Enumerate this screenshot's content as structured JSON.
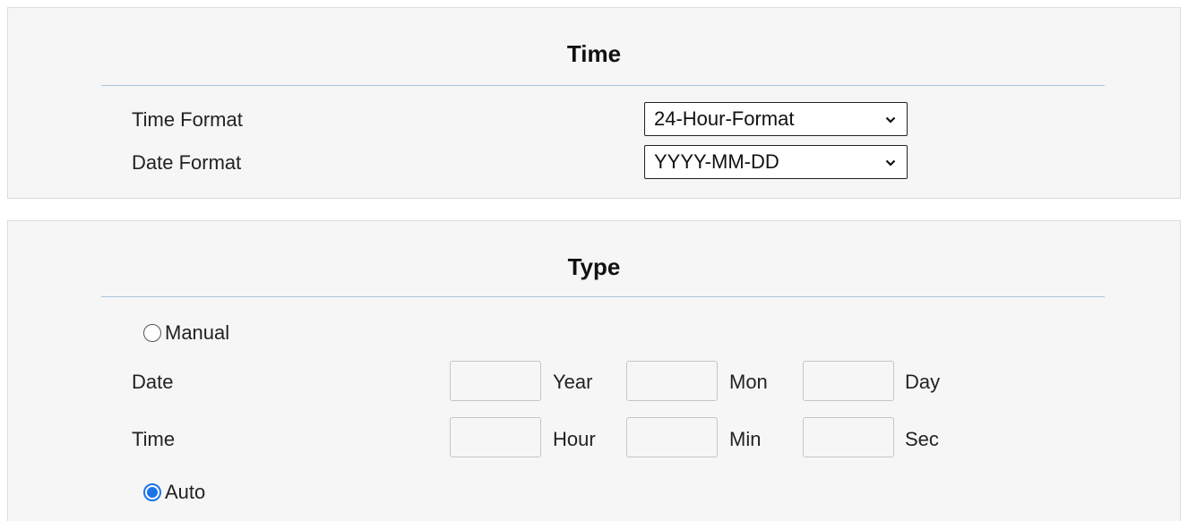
{
  "time_section": {
    "title": "Time",
    "time_format": {
      "label": "Time Format",
      "value": "24-Hour-Format"
    },
    "date_format": {
      "label": "Date Format",
      "value": "YYYY-MM-DD"
    }
  },
  "type_section": {
    "title": "Type",
    "manual": {
      "label": "Manual",
      "checked": false
    },
    "date_row": {
      "label": "Date",
      "year_unit": "Year",
      "month_unit": "Mon",
      "day_unit": "Day",
      "year_value": "",
      "month_value": "",
      "day_value": ""
    },
    "time_row": {
      "label": "Time",
      "hour_unit": "Hour",
      "minute_unit": "Min",
      "second_unit": "Sec",
      "hour_value": "",
      "minute_value": "",
      "second_value": ""
    },
    "auto": {
      "label": "Auto",
      "checked": true
    }
  },
  "colors": {
    "accent": "#1a73e8",
    "divider": "#a9c4dc",
    "panel_bg": "#f6f6f6"
  }
}
